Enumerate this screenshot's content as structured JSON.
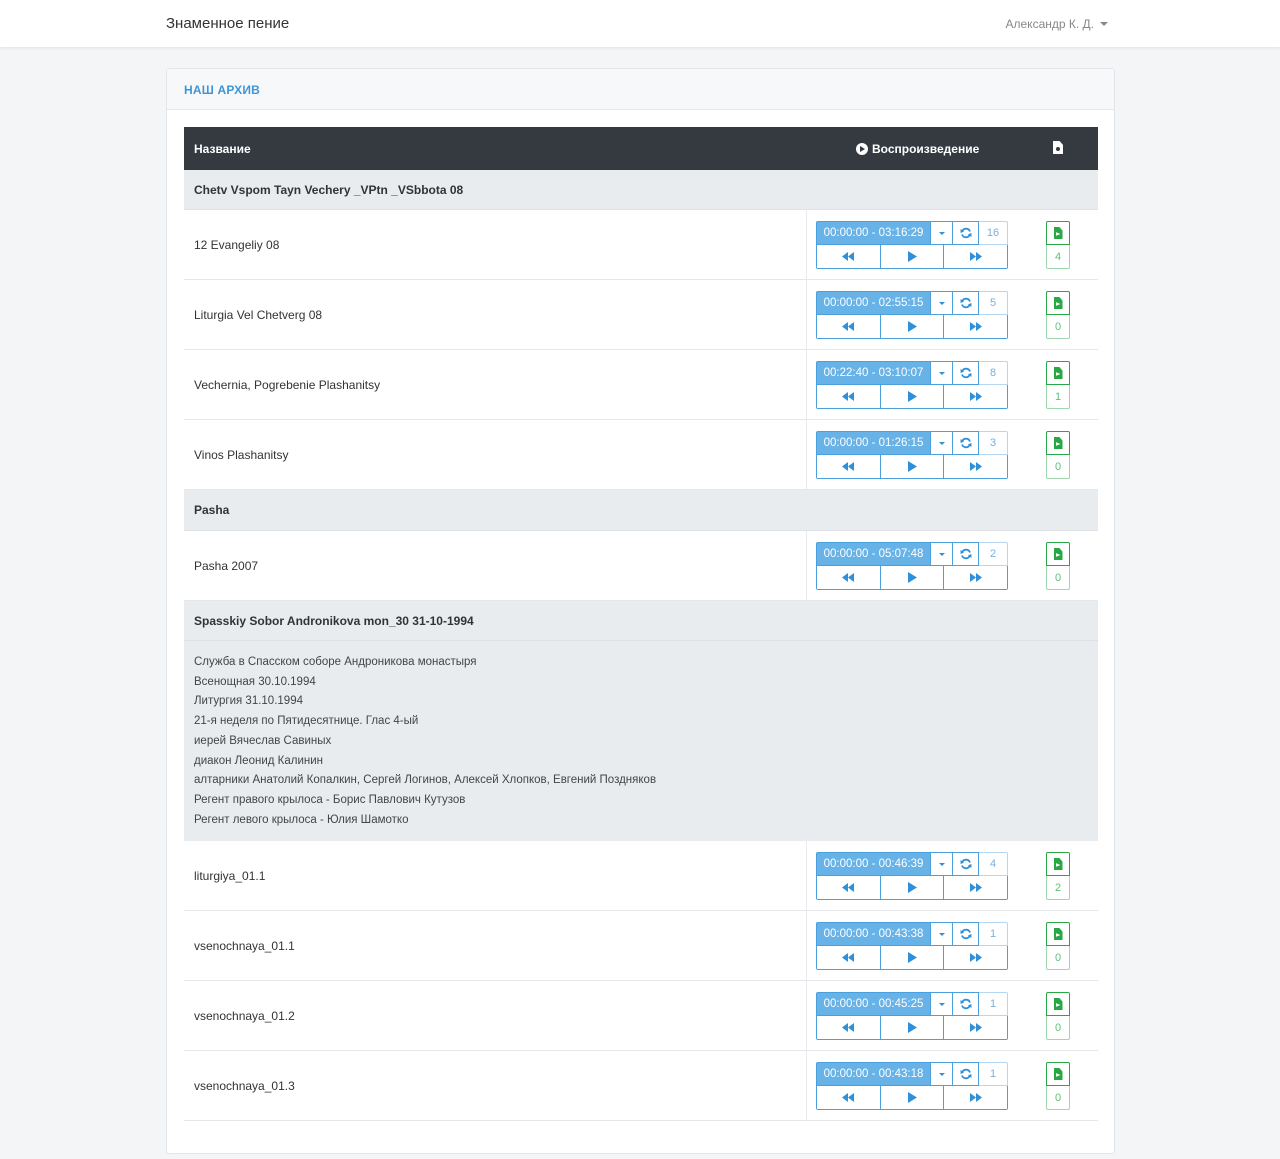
{
  "navbar": {
    "brand": "Знаменное пение",
    "user": "Александр К. Д."
  },
  "card": {
    "title": "НАШ АРХИВ"
  },
  "table": {
    "headers": {
      "name": "Название",
      "playback": "Воспроизведение"
    }
  },
  "groups": [
    {
      "title": "Chetv Vspom Tayn Vechery _VPtn _VSbbota 08",
      "tracks": [
        {
          "name": "12 Evangeliy 08",
          "time": "00:00:00 - 03:16:29",
          "plays": "16",
          "files": "4"
        },
        {
          "name": "Liturgia Vel Chetverg 08",
          "time": "00:00:00 - 02:55:15",
          "plays": "5",
          "files": "0"
        },
        {
          "name": "Vechernia, Pogrebenie Plashanitsy",
          "time": "00:22:40 - 03:10:07",
          "plays": "8",
          "files": "1"
        },
        {
          "name": "Vinos Plashanitsy",
          "time": "00:00:00 - 01:26:15",
          "plays": "3",
          "files": "0"
        }
      ]
    },
    {
      "title": "Pasha",
      "tracks": [
        {
          "name": "Pasha 2007",
          "time": "00:00:00 - 05:07:48",
          "plays": "2",
          "files": "0"
        }
      ]
    },
    {
      "title": "Spasskiy Sobor Andronikova mon_30 31-10-1994",
      "description": [
        "Служба в Спасском соборе Андроникова монастыря",
        "Всенощная 30.10.1994",
        "Литургия 31.10.1994",
        "21-я неделя по Пятидесятнице. Глас 4-ый",
        "иерей Вячеслав Савиных",
        "диакон Леонид Калинин",
        "алтарники Анатолий Копалкин, Сергей Логинов, Алексей Хлопков, Евгений Поздняков",
        "Регент правого крылоса - Борис Павлович Кутузов",
        "Регент левого крылоса - Юлия Шамотко"
      ],
      "tracks": [
        {
          "name": "liturgiya_01.1",
          "time": "00:00:00 - 00:46:39",
          "plays": "4",
          "files": "2"
        },
        {
          "name": "vsenochnaya_01.1",
          "time": "00:00:00 - 00:43:38",
          "plays": "1",
          "files": "0"
        },
        {
          "name": "vsenochnaya_01.2",
          "time": "00:00:00 - 00:45:25",
          "plays": "1",
          "files": "0"
        },
        {
          "name": "vsenochnaya_01.3",
          "time": "00:00:00 - 00:43:18",
          "plays": "1",
          "files": "0"
        }
      ]
    }
  ],
  "icons": {
    "header_play": "play-circle-icon",
    "header_file": "file-icon",
    "dropdown": "caret-down-icon",
    "repeat": "repeat-icon",
    "rewind": "backward-icon",
    "play": "play-icon",
    "forward": "forward-icon",
    "attachment": "file-download-icon"
  },
  "colors": {
    "accent": "#3d95d8",
    "time_button": "#67b2e6",
    "file_green": "#28a745",
    "table_header": "#343a40",
    "group_row": "#e9ecef"
  }
}
